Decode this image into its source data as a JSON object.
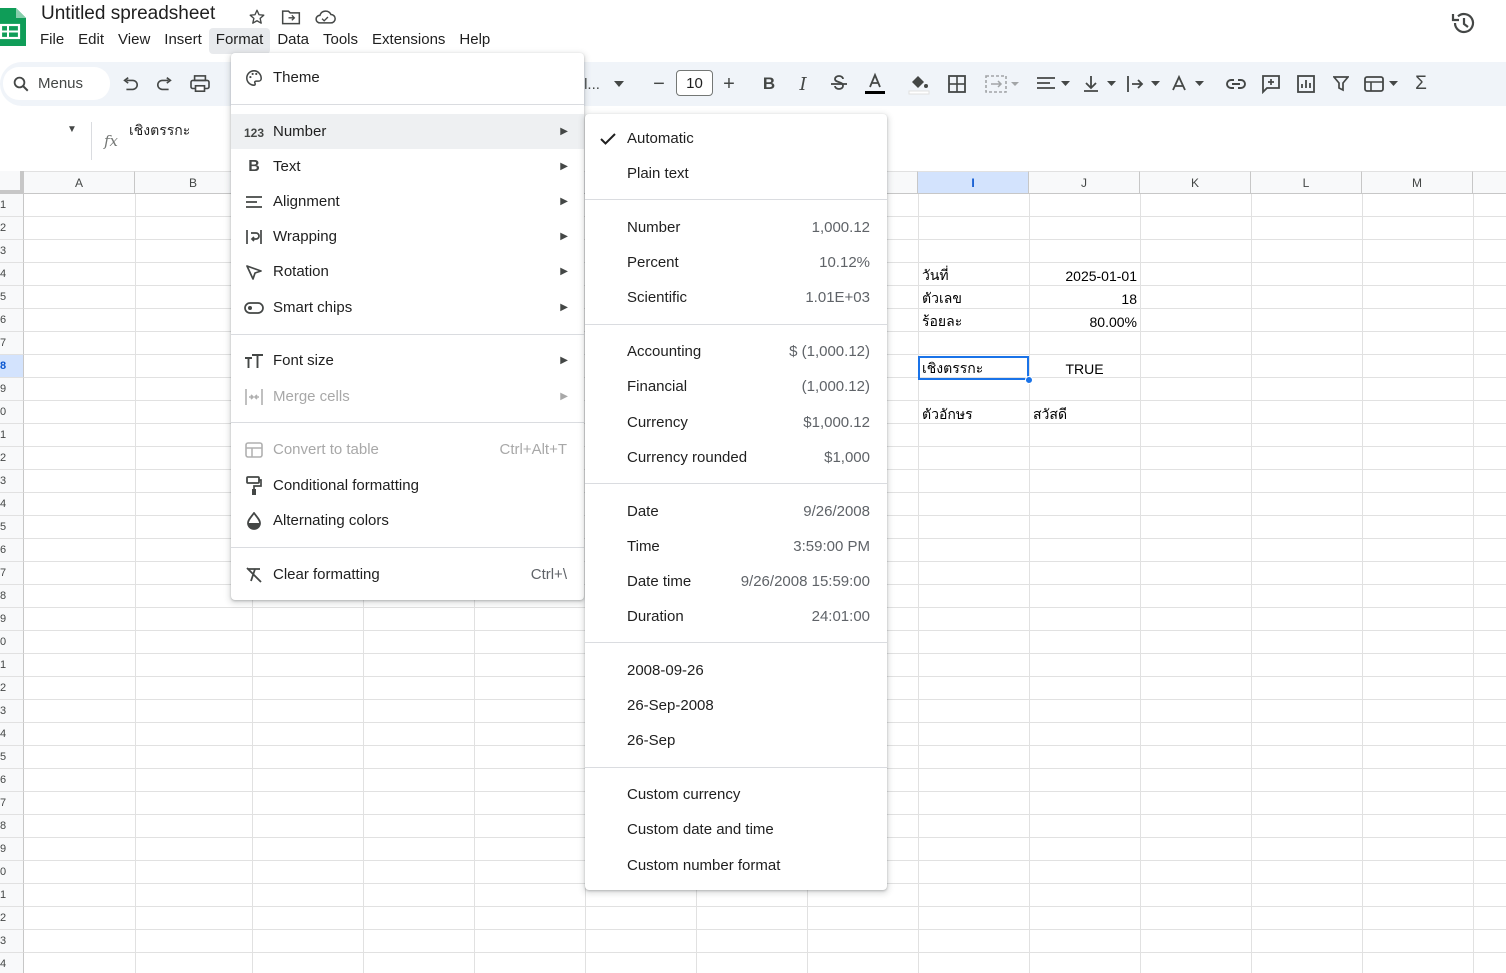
{
  "app": {
    "title": "Untitled spreadsheet",
    "menubar": [
      "File",
      "Edit",
      "View",
      "Insert",
      "Format",
      "Data",
      "Tools",
      "Extensions",
      "Help"
    ],
    "active_menu": "Format"
  },
  "toolbar": {
    "search_label": "Menus",
    "font_family_truncated": "l...",
    "font_size": "10",
    "minus": "−",
    "plus": "+"
  },
  "formula_bar": {
    "fx_label": "fx",
    "content": "เชิงตรรกะ"
  },
  "grid": {
    "columns": [
      "A",
      "B",
      "I",
      "J",
      "K",
      "L",
      "M"
    ],
    "selected_column": "I",
    "row_labels": [
      "1",
      "2",
      "3",
      "4",
      "5",
      "6",
      "7",
      "8",
      "9",
      "0",
      "1",
      "2",
      "3",
      "4",
      "5",
      "6",
      "7",
      "8",
      "9",
      "0",
      "1",
      "2",
      "3",
      "4",
      "5",
      "6",
      "7",
      "8",
      "9",
      "0",
      "1",
      "2",
      "3",
      "4"
    ],
    "selected_row_index": 7,
    "cells": {
      "I4": "วันที่",
      "J4": "2025-01-01",
      "I5": "ตัวเลข",
      "J5": "18",
      "I6": "ร้อยละ",
      "J6": "80.00%",
      "I8": "เชิงตรรกะ",
      "J8": "TRUE",
      "I10": "ตัวอักษร",
      "J10": "สวัสดี"
    }
  },
  "format_menu": {
    "items": [
      {
        "label": "Theme",
        "icon": "palette-icon"
      },
      {
        "label": "Number",
        "icon": "number-123-icon",
        "submenu": true,
        "highlighted": true
      },
      {
        "label": "Text",
        "icon": "bold-b-icon",
        "submenu": true
      },
      {
        "label": "Alignment",
        "icon": "align-left-icon",
        "submenu": true
      },
      {
        "label": "Wrapping",
        "icon": "wrap-icon",
        "submenu": true
      },
      {
        "label": "Rotation",
        "icon": "rotation-icon",
        "submenu": true
      },
      {
        "label": "Smart chips",
        "icon": "smart-chip-icon",
        "submenu": true
      },
      {
        "label": "Font size",
        "icon": "font-size-icon",
        "submenu": true
      },
      {
        "label": "Merge cells",
        "icon": "merge-cells-icon",
        "submenu": true,
        "disabled": true
      },
      {
        "label": "Convert to table",
        "icon": "table-icon",
        "shortcut": "Ctrl+Alt+T",
        "disabled": true
      },
      {
        "label": "Conditional formatting",
        "icon": "paint-roller-icon"
      },
      {
        "label": "Alternating colors",
        "icon": "color-drop-icon"
      },
      {
        "label": "Clear formatting",
        "icon": "clear-format-icon",
        "shortcut": "Ctrl+\\"
      }
    ]
  },
  "number_submenu": {
    "groups": [
      [
        {
          "label": "Automatic",
          "checked": true
        },
        {
          "label": "Plain text"
        }
      ],
      [
        {
          "label": "Number",
          "example": "1,000.12"
        },
        {
          "label": "Percent",
          "example": "10.12%"
        },
        {
          "label": "Scientific",
          "example": "1.01E+03"
        }
      ],
      [
        {
          "label": "Accounting",
          "example": "$ (1,000.12)"
        },
        {
          "label": "Financial",
          "example": "(1,000.12)"
        },
        {
          "label": "Currency",
          "example": "$1,000.12"
        },
        {
          "label": "Currency rounded",
          "example": "$1,000"
        }
      ],
      [
        {
          "label": "Date",
          "example": "9/26/2008"
        },
        {
          "label": "Time",
          "example": "3:59:00 PM"
        },
        {
          "label": "Date time",
          "example": "9/26/2008 15:59:00"
        },
        {
          "label": "Duration",
          "example": "24:01:00"
        }
      ],
      [
        {
          "label": "2008-09-26"
        },
        {
          "label": "26-Sep-2008"
        },
        {
          "label": "26-Sep"
        }
      ],
      [
        {
          "label": "Custom currency"
        },
        {
          "label": "Custom date and time"
        },
        {
          "label": "Custom number format"
        }
      ]
    ]
  },
  "colors": {
    "accent": "#1a73e8",
    "selected_header": "#d3e3fd",
    "toolbar_bg": "#f0f4f9",
    "sheets_green": "#0f9d58"
  }
}
